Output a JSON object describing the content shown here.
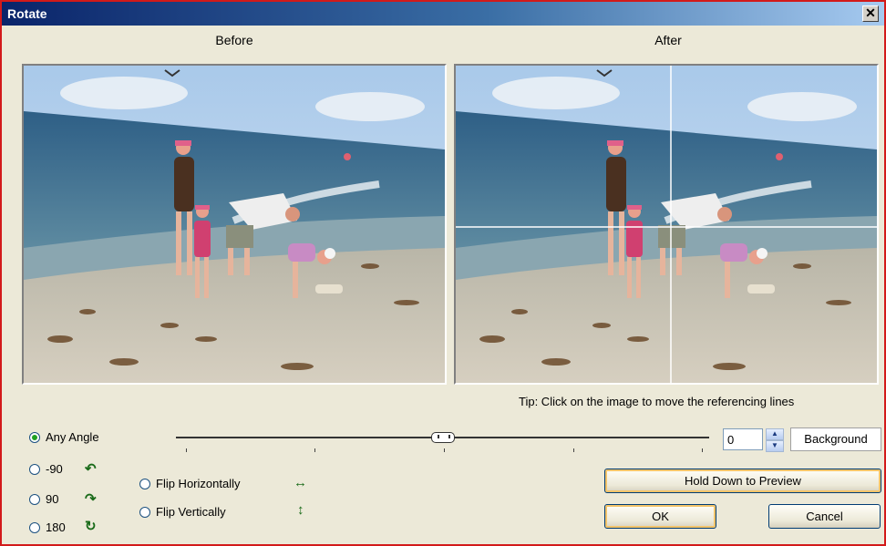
{
  "window": {
    "title": "Rotate",
    "close_label": "✕"
  },
  "panels": {
    "before_label": "Before",
    "after_label": "After"
  },
  "tip": "Tip: Click on the image to move the referencing lines",
  "options": {
    "any_angle": "Any Angle",
    "minus90": "-90",
    "plus90": "90",
    "r180": "180",
    "flip_h": "Flip Horizontally",
    "flip_v": "Flip Vertically",
    "selected": "any_angle"
  },
  "icons": {
    "minus90": "rotate-ccw-icon",
    "plus90": "rotate-cw-icon",
    "r180": "rotate-180-icon",
    "flip_h": "flip-horizontal-icon",
    "flip_v": "flip-vertical-icon"
  },
  "angle": {
    "value": "0",
    "slider_fraction": 0.5
  },
  "buttons": {
    "background": "Background",
    "hold_preview": "Hold Down to Preview",
    "ok": "OK",
    "cancel": "Cancel"
  },
  "colors": {
    "frame_red": "#d21a1a",
    "title_blue": "#0a246a",
    "dialog_bg": "#ece9d8"
  }
}
